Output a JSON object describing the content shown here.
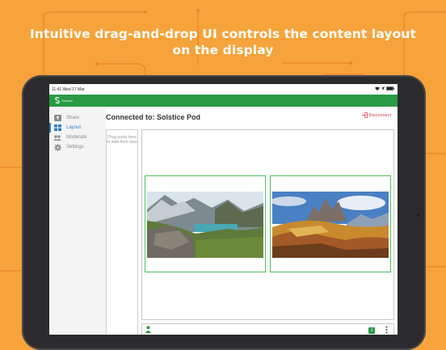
{
  "headline": {
    "line1": "Intuitive drag-and-drop UI controls the content layout",
    "line2": "on the display"
  },
  "statusbar": {
    "time": "11:41  Wed 17 Mar"
  },
  "app": {
    "name": "Solstice"
  },
  "sidebar": {
    "items": [
      {
        "label": "Share",
        "icon": "share-icon",
        "active": false
      },
      {
        "label": "Layout",
        "icon": "layout-icon",
        "active": true
      },
      {
        "label": "Moderate",
        "icon": "people-icon",
        "active": false
      },
      {
        "label": "Settings",
        "icon": "gear-icon",
        "active": false
      }
    ]
  },
  "header": {
    "title": "Connected to: Solstice Pod",
    "disconnect_label": "Disconnect"
  },
  "holding_area": {
    "hint": "Drag posts here to hide from view"
  },
  "posts": [
    {
      "name": "mountain-lake-photo"
    },
    {
      "name": "dolomites-peaks-photo"
    }
  ],
  "bottom_bar": {
    "badge": "1"
  },
  "colors": {
    "background": "#F6A33B",
    "app_green": "#2A9A45",
    "accent_blue": "#2E7CC4",
    "disconnect_red": "#D9394B",
    "post_border": "#4FBF62"
  }
}
